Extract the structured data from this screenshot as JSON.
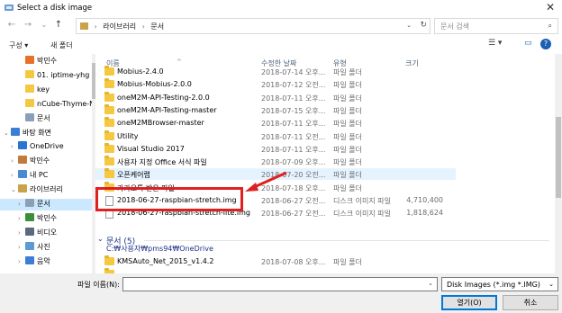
{
  "window": {
    "title": "Select a disk image",
    "close_glyph": "✕"
  },
  "nav": {
    "back": "←",
    "forward": "→",
    "recent": "⌄",
    "up": "↑",
    "breadcrumb": [
      "라이브러리",
      "문서"
    ],
    "breadcrumb_sep": "›",
    "refresh": "↻",
    "search_placeholder": "문서 검색",
    "search_icon": "search-icon"
  },
  "commands": {
    "organize": "구성 ▾",
    "new_folder": "새 폴더",
    "view_glyph": "☰ ▾",
    "pane_glyph": "▭",
    "help_glyph": "?"
  },
  "sidebar": [
    {
      "label": "박민수",
      "icon_color": "#e8702a",
      "chev": "",
      "indent": 20
    },
    {
      "label": "01. iptime-yhg",
      "icon_color": "#f5c842",
      "chev": "",
      "indent": 20
    },
    {
      "label": "key",
      "icon_color": "#f5c842",
      "chev": "",
      "indent": 20
    },
    {
      "label": "nCube-Thyme-N",
      "icon_color": "#f5c842",
      "chev": "",
      "indent": 20
    },
    {
      "label": "문서",
      "icon_color": "#8aa0b8",
      "chev": "",
      "indent": 20
    },
    {
      "label": "바탕 화면",
      "icon_color": "#3a7fd5",
      "chev": "⌄",
      "indent": 4
    },
    {
      "label": "OneDrive",
      "icon_color": "#2a74d6",
      "chev": "›",
      "indent": 12
    },
    {
      "label": "박민수",
      "icon_color": "#c07a3a",
      "chev": "›",
      "indent": 12
    },
    {
      "label": "내 PC",
      "icon_color": "#4a8ad0",
      "chev": "›",
      "indent": 12
    },
    {
      "label": "라이브러리",
      "icon_color": "#c9a24a",
      "chev": "⌄",
      "indent": 12
    },
    {
      "label": "문서",
      "icon_color": "#8aa0b8",
      "chev": "›",
      "indent": 20,
      "selected": true
    },
    {
      "label": "박민수",
      "icon_color": "#3b8f3b",
      "chev": "›",
      "indent": 20
    },
    {
      "label": "비디오",
      "icon_color": "#5a6b7b",
      "chev": "›",
      "indent": 20
    },
    {
      "label": "사진",
      "icon_color": "#5a9bd5",
      "chev": "›",
      "indent": 20
    },
    {
      "label": "음악",
      "icon_color": "#3a7fd5",
      "chev": "›",
      "indent": 20
    }
  ],
  "columns": {
    "name": "이름",
    "date": "수정한 날짜",
    "type": "유형",
    "size": "크기",
    "sort_glyph": "^"
  },
  "files": [
    {
      "name": "Mobius-2.4.0",
      "date": "2018-07-14 오후...",
      "type": "파일 폴더",
      "size": "",
      "kind": "folder"
    },
    {
      "name": "Mobius-Mobius-2.0.0",
      "date": "2018-07-12 오전...",
      "type": "파일 폴더",
      "size": "",
      "kind": "folder"
    },
    {
      "name": "oneM2M-API-Testing-2.0.0",
      "date": "2018-07-11 오후...",
      "type": "파일 폴더",
      "size": "",
      "kind": "folder"
    },
    {
      "name": "oneM2M-API-Testing-master",
      "date": "2018-07-15 오후...",
      "type": "파일 폴더",
      "size": "",
      "kind": "folder"
    },
    {
      "name": "oneM2MBrowser-master",
      "date": "2018-07-11 오후...",
      "type": "파일 폴더",
      "size": "",
      "kind": "folder"
    },
    {
      "name": "Utility",
      "date": "2018-07-11 오전...",
      "type": "파일 폴더",
      "size": "",
      "kind": "folder"
    },
    {
      "name": "Visual Studio 2017",
      "date": "2018-07-11 오후...",
      "type": "파일 폴더",
      "size": "",
      "kind": "folder"
    },
    {
      "name": "사용자 지정 Office 서식 파일",
      "date": "2018-07-09 오후...",
      "type": "파일 폴더",
      "size": "",
      "kind": "folder"
    },
    {
      "name": "오픈케어랩",
      "date": "2018-07-20 오전...",
      "type": "파일 폴더",
      "size": "",
      "kind": "folder",
      "highlight": true
    },
    {
      "name": "카카오톡 받은 파일",
      "date": "2018-07-18 오후...",
      "type": "파일 폴더",
      "size": "",
      "kind": "folder"
    },
    {
      "name": "2018-06-27-raspbian-stretch.img",
      "date": "2018-06-27 오전...",
      "type": "디스크 이미지 파일",
      "size": "4,710,400",
      "kind": "file"
    },
    {
      "name": "2018-06-27-raspbian-stretch-lite.img",
      "date": "2018-06-27 오전...",
      "type": "디스크 이미지 파일",
      "size": "1,818,624",
      "kind": "file"
    }
  ],
  "group": {
    "chev": "⌄",
    "label": "문서 (5)",
    "path": "C:₩사용자₩pms94₩OneDrive"
  },
  "group_files": [
    {
      "name": "KMSAuto_Net_2015_v1.4.2",
      "date": "2018-07-08 오후...",
      "type": "파일 폴더",
      "size": "",
      "kind": "folder"
    },
    {
      "name": "",
      "date": "",
      "type": "",
      "size": "",
      "kind": "folder"
    }
  ],
  "bottom": {
    "filename_label": "파일 이름(N):",
    "filename_value": "",
    "filter": "Disk Images (*.img *.IMG)",
    "open": "열기(O)",
    "cancel": "취소"
  },
  "colors": {
    "selection": "#cce8ff",
    "annotation": "#e02020",
    "accent": "#0078d7"
  }
}
